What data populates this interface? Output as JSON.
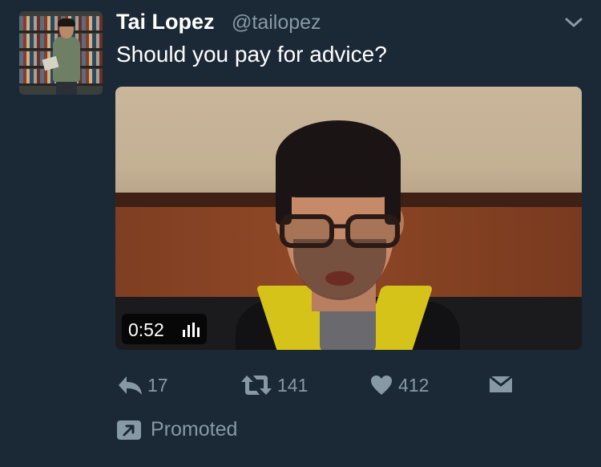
{
  "tweet": {
    "author_name": "Tai Lopez",
    "author_handle": "@tailopez",
    "text": "Should you pay for advice?",
    "avatar_icon": "user-avatar",
    "menu_icon": "chevron-down-icon"
  },
  "video": {
    "duration": "0:52",
    "volume_icon": "volume-bars-icon"
  },
  "actions": {
    "reply": {
      "icon": "reply-icon",
      "count": "17"
    },
    "retweet": {
      "icon": "retweet-icon",
      "count": "141"
    },
    "like": {
      "icon": "heart-icon",
      "count": "412"
    },
    "message": {
      "icon": "envelope-icon"
    }
  },
  "promoted": {
    "icon": "promoted-arrow-icon",
    "label": "Promoted"
  },
  "colors": {
    "background": "#1b2836",
    "secondary_text": "#8899a6",
    "primary_text": "#ffffff"
  }
}
